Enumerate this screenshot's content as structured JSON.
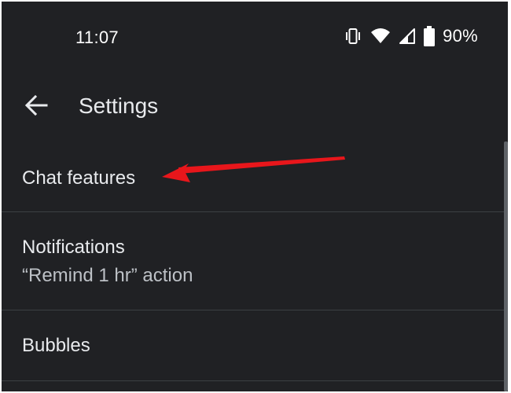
{
  "status_bar": {
    "time": "11:07",
    "battery": "90%",
    "icons": [
      "vibrate-icon",
      "wifi-icon",
      "cellular-signal-icon",
      "battery-icon"
    ]
  },
  "toolbar": {
    "back_icon": "arrow-back-icon",
    "title": "Settings"
  },
  "settings_list": [
    {
      "label": "Chat features"
    },
    {
      "label": "Notifications",
      "sublabel": "“Remind 1 hr” action"
    },
    {
      "label": "Bubbles"
    }
  ],
  "annotation": {
    "type": "arrow",
    "color": "#e8161b",
    "points_to": "Chat features"
  },
  "colors": {
    "background": "#202124",
    "text_primary": "#e8eaed",
    "text_secondary": "#bdc1c6",
    "divider": "#3c4043"
  }
}
